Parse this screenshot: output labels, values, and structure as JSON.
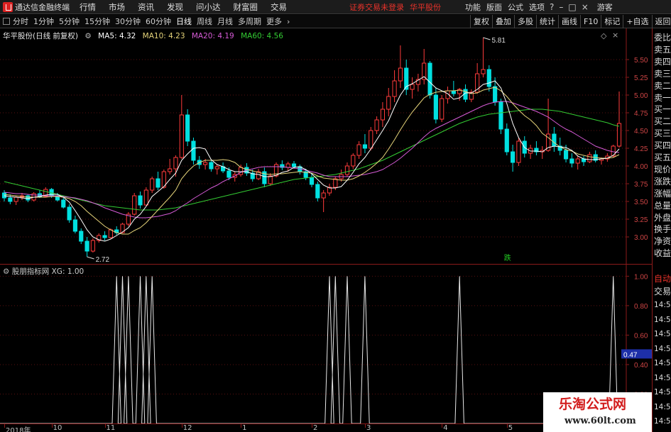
{
  "topbar": {
    "title": "通达信金融终端",
    "menus": [
      "行情",
      "市场",
      "资讯",
      "发现",
      "问小达",
      "财富圈",
      "交易"
    ],
    "trade_status": "证券交易未登录",
    "stock_name": "华平股份",
    "right_menus": [
      "功能",
      "版面",
      "公式",
      "选项"
    ],
    "guest": "游客"
  },
  "toolbar": {
    "periods": [
      "分时",
      "1分钟",
      "5分钟",
      "15分钟",
      "30分钟",
      "60分钟",
      "日线",
      "周线",
      "月线",
      "多周期",
      "更多"
    ],
    "active_period": "日线",
    "more_icon": "chevron-right-icon",
    "right_buttons": [
      "复权",
      "叠加",
      "多股",
      "统计",
      "画线",
      "F10",
      "标记",
      "+自选",
      "返回"
    ]
  },
  "legend": {
    "title": "华平股份(日线 前复权)",
    "ma5": "MA5: 4.32",
    "ma10": "MA10: 4.23",
    "ma20": "MA20: 4.19",
    "ma60": "MA60: 4.56"
  },
  "sub_legend": {
    "name": "股朋指标网",
    "value": "XG: 1.00"
  },
  "colors": {
    "up": "#ff3b3b",
    "down": "#00e0e0",
    "ma5": "#ffffff",
    "ma10": "#e6d47a",
    "ma20": "#d65bd6",
    "ma60": "#33cc33",
    "signal": "#e8e8e8"
  },
  "chart_data": {
    "type": "candlestick",
    "price_axis": {
      "ticks": [
        "5.50",
        "5.25",
        "5.00",
        "4.75",
        "4.50",
        "4.25",
        "4.00",
        "3.75",
        "3.50",
        "3.25",
        "3.00"
      ],
      "range": [
        2.62,
        5.94
      ]
    },
    "annotations": {
      "high_label": "5.81",
      "low_label": "2.72",
      "event_label": "跌"
    },
    "candles": [
      [
        3.62,
        3.66,
        3.5,
        3.55
      ],
      [
        3.55,
        3.6,
        3.46,
        3.5
      ],
      [
        3.5,
        3.58,
        3.45,
        3.56
      ],
      [
        3.56,
        3.62,
        3.52,
        3.58
      ],
      [
        3.58,
        3.6,
        3.49,
        3.52
      ],
      [
        3.52,
        3.63,
        3.5,
        3.61
      ],
      [
        3.61,
        3.66,
        3.55,
        3.57
      ],
      [
        3.57,
        3.7,
        3.56,
        3.67
      ],
      [
        3.67,
        3.69,
        3.55,
        3.58
      ],
      [
        3.58,
        3.62,
        3.5,
        3.52
      ],
      [
        3.52,
        3.55,
        3.4,
        3.42
      ],
      [
        3.42,
        3.46,
        3.2,
        3.24
      ],
      [
        3.24,
        3.3,
        3.05,
        3.08
      ],
      [
        3.08,
        3.12,
        2.9,
        2.94
      ],
      [
        2.94,
        3.0,
        2.72,
        2.8
      ],
      [
        2.8,
        2.98,
        2.78,
        2.95
      ],
      [
        2.95,
        3.05,
        2.92,
        3.02
      ],
      [
        3.02,
        3.08,
        2.95,
        2.99
      ],
      [
        2.99,
        3.12,
        2.98,
        3.1
      ],
      [
        3.1,
        3.15,
        3.03,
        3.06
      ],
      [
        3.06,
        3.2,
        3.05,
        3.18
      ],
      [
        3.18,
        3.35,
        3.15,
        3.32
      ],
      [
        3.32,
        3.62,
        3.3,
        3.58
      ],
      [
        3.58,
        3.64,
        3.4,
        3.45
      ],
      [
        3.45,
        3.7,
        3.44,
        3.66
      ],
      [
        3.66,
        3.85,
        3.62,
        3.82
      ],
      [
        3.82,
        3.92,
        3.66,
        3.7
      ],
      [
        3.7,
        3.95,
        3.68,
        3.92
      ],
      [
        3.92,
        4.1,
        3.88,
        3.96
      ],
      [
        3.96,
        4.15,
        3.85,
        4.12
      ],
      [
        4.12,
        5.0,
        4.1,
        4.72
      ],
      [
        4.72,
        4.8,
        4.28,
        4.35
      ],
      [
        4.35,
        4.4,
        4.02,
        4.08
      ],
      [
        4.08,
        4.14,
        3.96,
        4.02
      ],
      [
        4.02,
        4.1,
        3.95,
        4.05
      ],
      [
        4.05,
        4.08,
        3.92,
        3.96
      ],
      [
        3.96,
        4.02,
        3.88,
        3.99
      ],
      [
        3.99,
        4.05,
        3.9,
        3.93
      ],
      [
        3.93,
        3.98,
        3.8,
        3.84
      ],
      [
        3.84,
        3.92,
        3.78,
        3.88
      ],
      [
        3.88,
        4.02,
        3.85,
        3.98
      ],
      [
        3.98,
        4.04,
        3.86,
        3.9
      ],
      [
        3.9,
        3.95,
        3.78,
        3.82
      ],
      [
        3.82,
        3.96,
        3.8,
        3.92
      ],
      [
        3.92,
        3.98,
        3.7,
        3.75
      ],
      [
        3.75,
        3.9,
        3.72,
        3.86
      ],
      [
        3.86,
        4.05,
        3.84,
        4.02
      ],
      [
        4.02,
        4.08,
        3.94,
        3.98
      ],
      [
        3.98,
        4.06,
        3.92,
        4.03
      ],
      [
        4.03,
        4.07,
        3.96,
        3.99
      ],
      [
        3.99,
        4.02,
        3.88,
        3.92
      ],
      [
        3.92,
        3.96,
        3.8,
        3.84
      ],
      [
        3.84,
        3.9,
        3.7,
        3.74
      ],
      [
        3.74,
        3.78,
        3.5,
        3.55
      ],
      [
        3.55,
        3.66,
        3.35,
        3.62
      ],
      [
        3.62,
        3.75,
        3.58,
        3.7
      ],
      [
        3.7,
        3.85,
        3.66,
        3.82
      ],
      [
        3.82,
        3.95,
        3.78,
        3.88
      ],
      [
        3.88,
        4.05,
        3.85,
        4.0
      ],
      [
        4.0,
        4.18,
        3.96,
        4.15
      ],
      [
        4.15,
        4.35,
        4.1,
        4.3
      ],
      [
        4.3,
        4.45,
        4.18,
        4.25
      ],
      [
        4.25,
        4.55,
        4.22,
        4.5
      ],
      [
        4.5,
        4.7,
        4.45,
        4.65
      ],
      [
        4.65,
        4.9,
        4.55,
        4.8
      ],
      [
        4.8,
        5.1,
        4.7,
        4.98
      ],
      [
        4.98,
        5.35,
        4.9,
        5.2
      ],
      [
        5.2,
        5.7,
        5.1,
        5.38
      ],
      [
        5.38,
        5.5,
        5.0,
        5.08
      ],
      [
        5.08,
        5.25,
        4.95,
        5.15
      ],
      [
        5.15,
        5.3,
        5.05,
        5.22
      ],
      [
        5.22,
        5.65,
        5.15,
        5.45
      ],
      [
        5.45,
        5.48,
        4.95,
        5.0
      ],
      [
        5.0,
        5.1,
        4.6,
        4.66
      ],
      [
        4.66,
        5.0,
        4.62,
        4.95
      ],
      [
        4.95,
        5.12,
        4.88,
        5.06
      ],
      [
        5.06,
        5.2,
        4.98,
        5.02
      ],
      [
        5.02,
        5.1,
        4.92,
        5.08
      ],
      [
        5.08,
        5.15,
        4.9,
        4.94
      ],
      [
        4.94,
        5.08,
        4.9,
        5.04
      ],
      [
        5.04,
        5.45,
        5.02,
        5.3
      ],
      [
        5.3,
        5.81,
        5.25,
        5.36
      ],
      [
        5.36,
        5.42,
        5.05,
        5.12
      ],
      [
        5.12,
        5.25,
        4.85,
        4.9
      ],
      [
        4.9,
        4.95,
        4.45,
        4.52
      ],
      [
        4.52,
        4.6,
        4.15,
        4.2
      ],
      [
        4.2,
        4.3,
        3.92,
        4.05
      ],
      [
        4.05,
        4.4,
        4.0,
        4.35
      ],
      [
        4.35,
        4.42,
        4.12,
        4.18
      ],
      [
        4.18,
        4.3,
        4.1,
        4.25
      ],
      [
        4.25,
        4.35,
        4.15,
        4.2
      ],
      [
        4.2,
        4.28,
        4.1,
        4.22
      ],
      [
        4.22,
        4.95,
        4.2,
        4.45
      ],
      [
        4.45,
        4.55,
        4.2,
        4.28
      ],
      [
        4.28,
        4.4,
        4.15,
        4.22
      ],
      [
        4.22,
        4.3,
        4.05,
        4.1
      ],
      [
        4.1,
        4.18,
        3.98,
        4.04
      ],
      [
        4.04,
        4.15,
        3.95,
        4.1
      ],
      [
        4.1,
        4.14,
        4.0,
        4.06
      ],
      [
        4.06,
        4.2,
        4.04,
        4.16
      ],
      [
        4.16,
        4.22,
        4.05,
        4.08
      ],
      [
        4.08,
        4.12,
        4.02,
        4.1
      ],
      [
        4.1,
        4.18,
        4.06,
        4.14
      ],
      [
        4.14,
        4.3,
        4.12,
        4.28
      ],
      [
        4.28,
        5.05,
        4.26,
        4.6
      ]
    ],
    "ma5": [
      3.58,
      3.57,
      3.56,
      3.55,
      3.54,
      3.56,
      3.57,
      3.59,
      3.6,
      3.6,
      3.56,
      3.49,
      3.37,
      3.24,
      3.1,
      3.0,
      2.96,
      2.94,
      2.97,
      3.02,
      3.07,
      3.13,
      3.25,
      3.32,
      3.43,
      3.57,
      3.64,
      3.71,
      3.81,
      3.9,
      4.08,
      4.17,
      4.25,
      4.26,
      4.24,
      4.09,
      4.02,
      3.99,
      3.95,
      3.92,
      3.92,
      3.92,
      3.89,
      3.88,
      3.85,
      3.85,
      3.87,
      3.91,
      3.93,
      3.98,
      3.99,
      3.95,
      3.89,
      3.81,
      3.73,
      3.69,
      3.69,
      3.71,
      3.8,
      3.91,
      4.03,
      4.12,
      4.24,
      4.37,
      4.5,
      4.64,
      4.83,
      5.0,
      5.12,
      5.16,
      5.21,
      5.26,
      5.18,
      5.1,
      5.06,
      5.02,
      4.94,
      4.96,
      5.03,
      5.03,
      5.08,
      5.15,
      5.17,
      5.2,
      5.1,
      4.88,
      4.6,
      4.4,
      4.26,
      4.21,
      4.21,
      4.2,
      4.26,
      4.28,
      4.27,
      4.26,
      4.22,
      4.14,
      4.1,
      4.09,
      4.09,
      4.1,
      4.11,
      4.15,
      4.24
    ],
    "ma10": [
      3.6,
      3.59,
      3.58,
      3.57,
      3.56,
      3.56,
      3.56,
      3.56,
      3.57,
      3.57,
      3.56,
      3.54,
      3.5,
      3.44,
      3.36,
      3.29,
      3.22,
      3.15,
      3.1,
      3.06,
      3.04,
      3.04,
      3.09,
      3.13,
      3.2,
      3.29,
      3.38,
      3.47,
      3.56,
      3.66,
      3.82,
      3.92,
      4.0,
      4.05,
      4.08,
      4.08,
      4.08,
      4.09,
      4.08,
      4.05,
      3.98,
      3.95,
      3.93,
      3.91,
      3.89,
      3.88,
      3.89,
      3.89,
      3.9,
      3.91,
      3.92,
      3.91,
      3.9,
      3.86,
      3.83,
      3.82,
      3.81,
      3.8,
      3.8,
      3.82,
      3.86,
      3.91,
      3.97,
      4.04,
      4.12,
      4.24,
      4.37,
      4.51,
      4.64,
      4.76,
      4.86,
      4.96,
      5.01,
      5.04,
      5.05,
      5.06,
      5.06,
      5.07,
      5.05,
      5.02,
      5.03,
      5.07,
      5.09,
      5.11,
      5.06,
      4.98,
      4.88,
      4.79,
      4.71,
      4.65,
      4.57,
      4.46,
      4.4,
      4.33,
      4.27,
      4.23,
      4.21,
      4.17,
      4.15,
      4.13,
      4.12,
      4.11,
      4.11,
      4.12,
      4.16
    ],
    "ma20": [
      3.63,
      3.62,
      3.61,
      3.61,
      3.6,
      3.59,
      3.59,
      3.58,
      3.58,
      3.58,
      3.57,
      3.56,
      3.55,
      3.53,
      3.51,
      3.48,
      3.45,
      3.41,
      3.38,
      3.35,
      3.32,
      3.3,
      3.28,
      3.27,
      3.27,
      3.28,
      3.29,
      3.31,
      3.33,
      3.37,
      3.43,
      3.48,
      3.54,
      3.59,
      3.64,
      3.69,
      3.73,
      3.78,
      3.82,
      3.86,
      3.91,
      3.94,
      3.96,
      3.98,
      3.99,
      3.99,
      3.99,
      3.99,
      3.98,
      3.97,
      3.96,
      3.94,
      3.92,
      3.9,
      3.87,
      3.85,
      3.85,
      3.85,
      3.85,
      3.86,
      3.87,
      3.88,
      3.9,
      3.92,
      3.95,
      4.0,
      4.05,
      4.11,
      4.18,
      4.25,
      4.33,
      4.41,
      4.48,
      4.53,
      4.57,
      4.61,
      4.65,
      4.69,
      4.73,
      4.77,
      4.81,
      4.85,
      4.88,
      4.9,
      4.91,
      4.91,
      4.89,
      4.86,
      4.83,
      4.8,
      4.77,
      4.73,
      4.69,
      4.63,
      4.57,
      4.52,
      4.48,
      4.43,
      4.38,
      4.33,
      4.28,
      4.25,
      4.22,
      4.2,
      4.19
    ],
    "ma60": [
      3.78,
      3.76,
      3.74,
      3.72,
      3.7,
      3.68,
      3.66,
      3.64,
      3.62,
      3.6,
      3.58,
      3.56,
      3.54,
      3.52,
      3.5,
      3.48,
      3.46,
      3.44,
      3.43,
      3.42,
      3.41,
      3.4,
      3.39,
      3.38,
      3.38,
      3.38,
      3.38,
      3.39,
      3.4,
      3.41,
      3.43,
      3.45,
      3.47,
      3.49,
      3.51,
      3.53,
      3.55,
      3.57,
      3.59,
      3.61,
      3.63,
      3.65,
      3.67,
      3.69,
      3.71,
      3.73,
      3.75,
      3.77,
      3.79,
      3.81,
      3.82,
      3.83,
      3.84,
      3.85,
      3.86,
      3.87,
      3.88,
      3.9,
      3.92,
      3.94,
      3.96,
      3.99,
      4.02,
      4.05,
      4.08,
      4.12,
      4.16,
      4.2,
      4.24,
      4.28,
      4.32,
      4.36,
      4.4,
      4.44,
      4.48,
      4.52,
      4.56,
      4.6,
      4.63,
      4.66,
      4.69,
      4.71,
      4.73,
      4.74,
      4.75,
      4.76,
      4.77,
      4.78,
      4.79,
      4.8,
      4.8,
      4.8,
      4.79,
      4.78,
      4.77,
      4.75,
      4.73,
      4.71,
      4.69,
      4.67,
      4.65,
      4.63,
      4.61,
      4.58,
      4.56
    ],
    "signal_axis": {
      "ticks": [
        "1.00",
        "0.80",
        "0.60",
        "0.40",
        "0.20"
      ],
      "current": "0.47",
      "range": [
        0,
        1.05
      ]
    },
    "signal_spikes": [
      19,
      20,
      21,
      23,
      24,
      25,
      55,
      56,
      58,
      61,
      77,
      103
    ],
    "time_labels": [
      {
        "label": "2018年",
        "i": 0
      },
      {
        "label": "10",
        "i": 8
      },
      {
        "label": "11",
        "i": 17
      },
      {
        "label": "12",
        "i": 30
      },
      {
        "label": "1",
        "i": 40
      },
      {
        "label": "2",
        "i": 52
      },
      {
        "label": "3",
        "i": 61
      },
      {
        "label": "4",
        "i": 74
      },
      {
        "label": "5",
        "i": 85
      }
    ]
  },
  "right_panel": {
    "labels": [
      "委比",
      "卖五",
      "卖四",
      "卖三",
      "卖二",
      "卖一",
      "买一",
      "买二",
      "买三",
      "买四",
      "买五",
      "现价",
      "涨跌",
      "涨幅",
      "总量",
      "外盘",
      "换手",
      "净资",
      "收益"
    ],
    "auto_trade": "自动",
    "trade": "交易",
    "times": [
      "14:5",
      "14:5",
      "14:5",
      "14:5",
      "14:5",
      "14:5",
      "14:5",
      "14:5",
      "14:5"
    ]
  },
  "watermark": {
    "title": "乐淘公式网",
    "url": "www.60lt.com"
  }
}
